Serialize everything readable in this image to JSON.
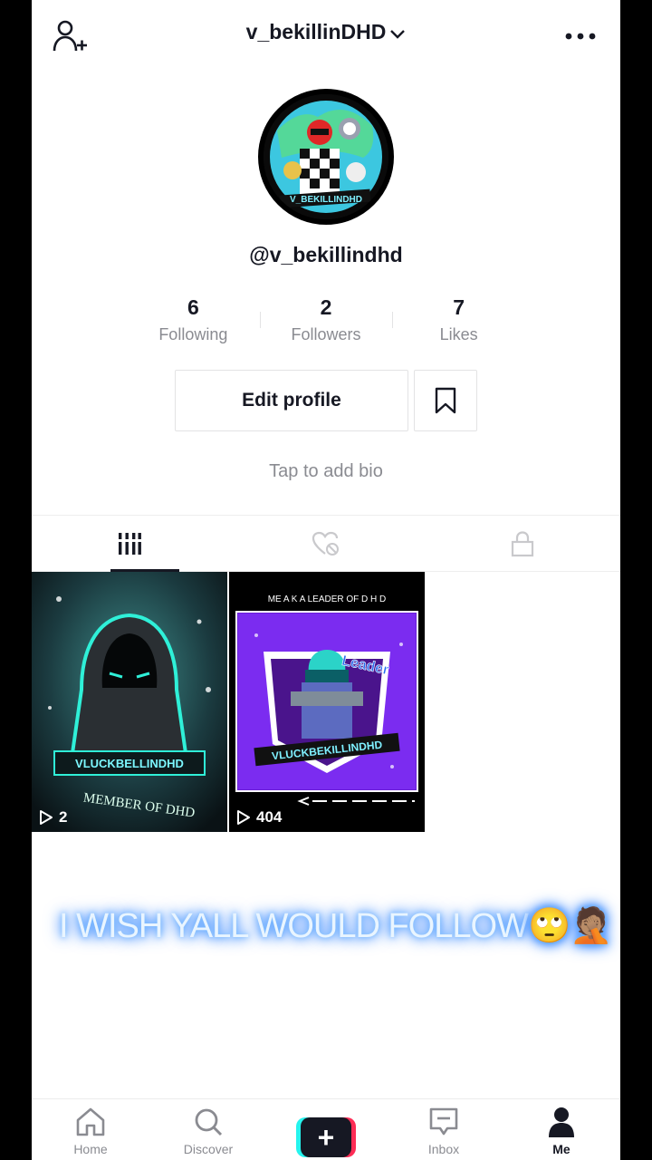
{
  "header": {
    "title": "v_bekillinDHD",
    "icons": [
      "add-user-icon",
      "chevron-down-icon",
      "more-icon"
    ]
  },
  "profile": {
    "username": "@v_bekillindhd",
    "avatar_text": "V_BEKILLINDHD",
    "stats": [
      {
        "value": "6",
        "label": "Following"
      },
      {
        "value": "2",
        "label": "Followers"
      },
      {
        "value": "7",
        "label": "Likes"
      }
    ],
    "edit_label": "Edit profile",
    "bio_placeholder": "Tap to add bio"
  },
  "tabs": [
    "grid-icon",
    "liked-hidden-icon",
    "lock-icon"
  ],
  "videos": [
    {
      "title": "VLUCKBELLINDHD",
      "subtitle": "MEMBER OF DHD",
      "views": "2"
    },
    {
      "header": "ME A K A LEADER OF D H D",
      "badge": "Leader",
      "title": "VLUCKBEKILLINDHD",
      "views": "404"
    }
  ],
  "caption": "I WISH YALL WOULD FOLLOW",
  "caption_emoji": "🙄🤦🏽",
  "nav": [
    {
      "label": "Home",
      "icon": "home-icon"
    },
    {
      "label": "Discover",
      "icon": "search-icon"
    },
    {
      "label": "",
      "icon": "create-icon"
    },
    {
      "label": "Inbox",
      "icon": "inbox-icon"
    },
    {
      "label": "Me",
      "icon": "person-icon"
    }
  ],
  "colors": {
    "text": "#161823",
    "muted": "#8a8b91",
    "accent_cyan": "#25f4ee",
    "accent_red": "#fe2c55"
  }
}
